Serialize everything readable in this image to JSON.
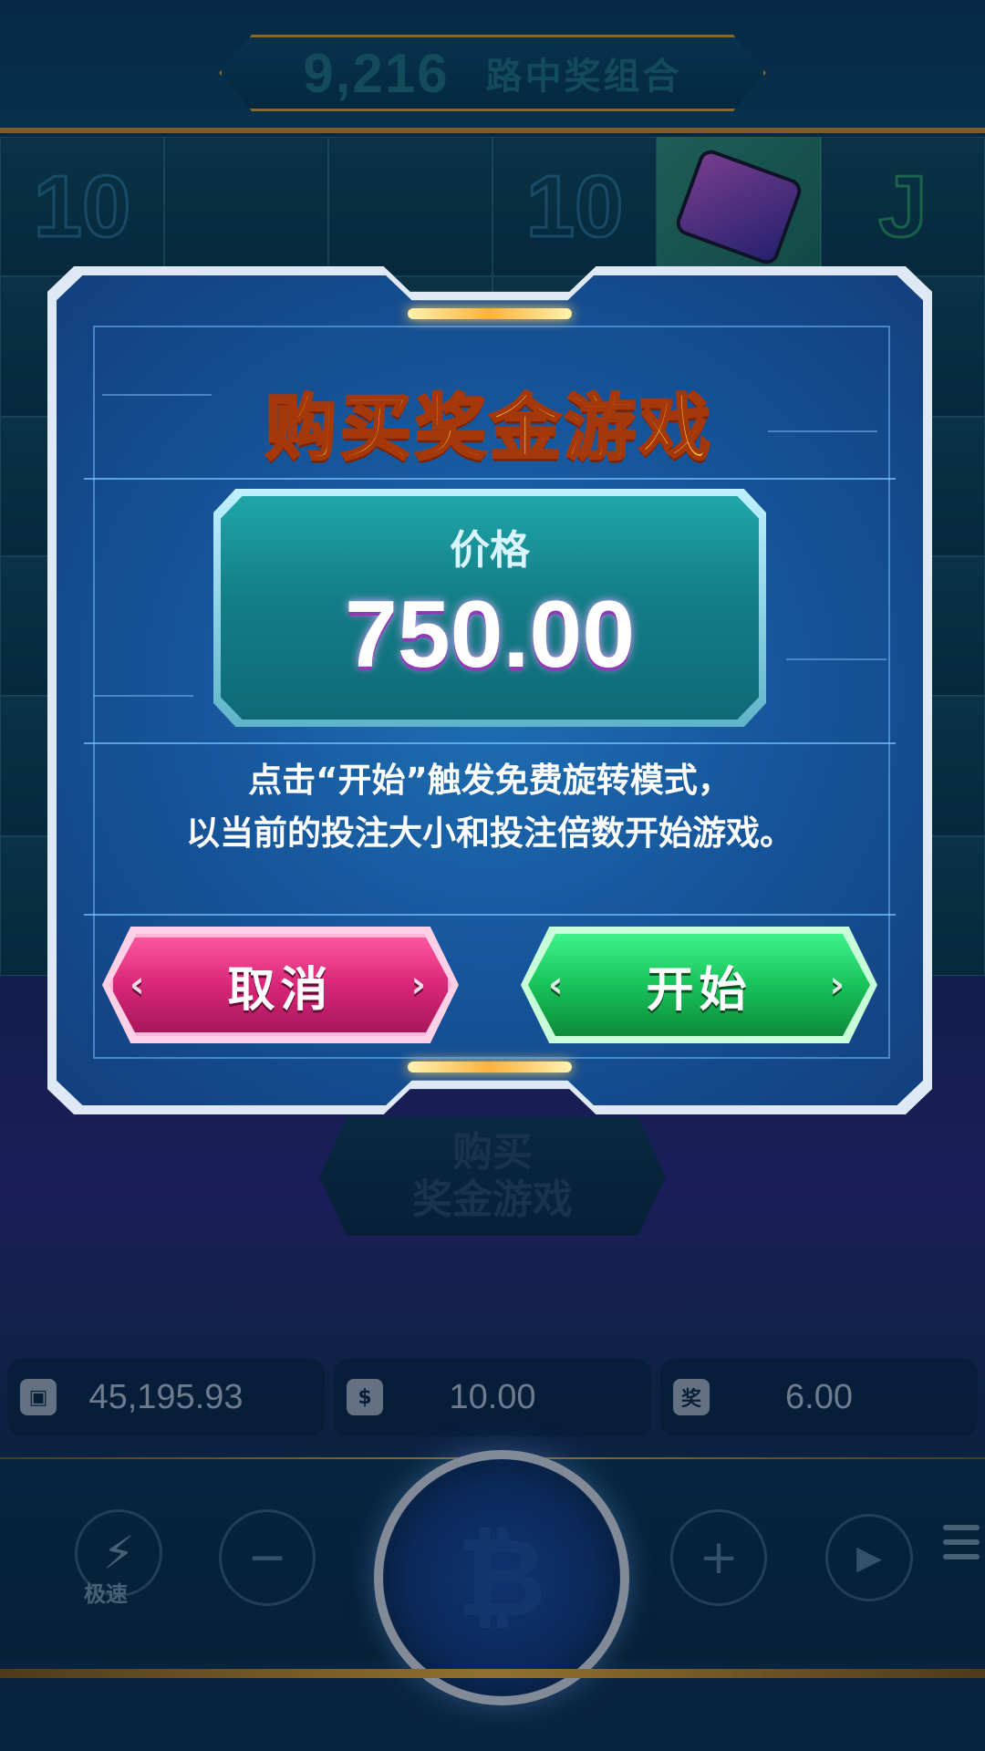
{
  "header": {
    "ways_count": "9,216",
    "ways_label": "路中奖组合"
  },
  "reels": {
    "cells": [
      "10",
      "",
      "",
      "10",
      "phone",
      "J",
      "",
      "",
      "",
      "",
      "",
      "",
      "",
      "",
      "",
      "",
      "",
      "",
      "",
      "",
      "",
      "",
      "",
      "",
      "",
      "",
      "",
      "",
      "",
      "",
      "",
      "",
      "",
      "",
      "",
      ""
    ]
  },
  "background_buy_button": {
    "line1": "购买",
    "line2": "奖金游戏"
  },
  "info_bar": {
    "balance": "45,195.93",
    "bet": "10.00",
    "win": "6.00",
    "win_icon_glyph": "奖"
  },
  "controls": {
    "turbo_label": "极速",
    "minus_glyph": "−",
    "plus_glyph": "+",
    "autoplay_glyph": "▶",
    "spin_glyph": "₿"
  },
  "modal": {
    "title": "购买奖金游戏",
    "price_label": "价格",
    "price_value": "750.00",
    "description_line1": "点击“开始”触发免费旋转模式，",
    "description_line2": "以当前的投注大小和投注倍数开始游戏。",
    "cancel_label": "取消",
    "start_label": "开始"
  },
  "colors": {
    "title_gold": "#ffd23f",
    "cancel_pink": "#d92678",
    "start_green": "#18c35a",
    "price_teal": "#137e86"
  }
}
